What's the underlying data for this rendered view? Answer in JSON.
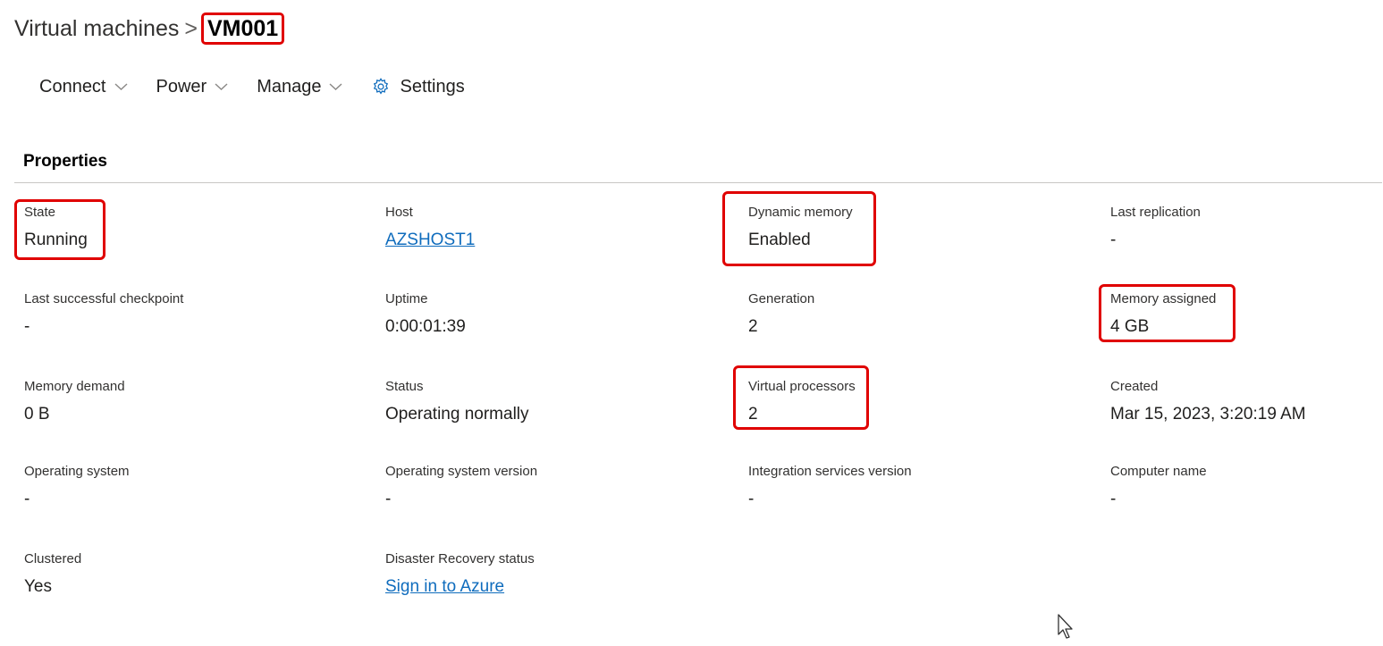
{
  "breadcrumb": {
    "parent": "Virtual machines",
    "separator": ">",
    "current": "VM001"
  },
  "toolbar": {
    "connect": "Connect",
    "power": "Power",
    "manage": "Manage",
    "settings": "Settings"
  },
  "section_title": "Properties",
  "properties": [
    {
      "label": "State",
      "value": "Running"
    },
    {
      "label": "Host",
      "value": "AZSHOST1"
    },
    {
      "label": "Dynamic memory",
      "value": "Enabled"
    },
    {
      "label": "Last replication",
      "value": "-"
    },
    {
      "label": "Last successful checkpoint",
      "value": "-"
    },
    {
      "label": "Uptime",
      "value": "0:00:01:39"
    },
    {
      "label": "Generation",
      "value": "2"
    },
    {
      "label": "Memory assigned",
      "value": "4 GB"
    },
    {
      "label": "Memory demand",
      "value": "0 B"
    },
    {
      "label": "Status",
      "value": "Operating normally"
    },
    {
      "label": "Virtual processors",
      "value": "2"
    },
    {
      "label": "Created",
      "value": "Mar 15, 2023, 3:20:19 AM"
    },
    {
      "label": "Operating system",
      "value": "-"
    },
    {
      "label": "Operating system version",
      "value": "-"
    },
    {
      "label": "Integration services version",
      "value": "-"
    },
    {
      "label": "Computer name",
      "value": "-"
    },
    {
      "label": "Clustered",
      "value": "Yes"
    },
    {
      "label": "Disaster Recovery status",
      "value": "Sign in to Azure"
    }
  ],
  "colors": {
    "highlight": "#e00000",
    "link": "#0f6cbd"
  },
  "icons": [
    "chevron-down-icon",
    "gear-icon",
    "mouse-pointer-icon"
  ]
}
